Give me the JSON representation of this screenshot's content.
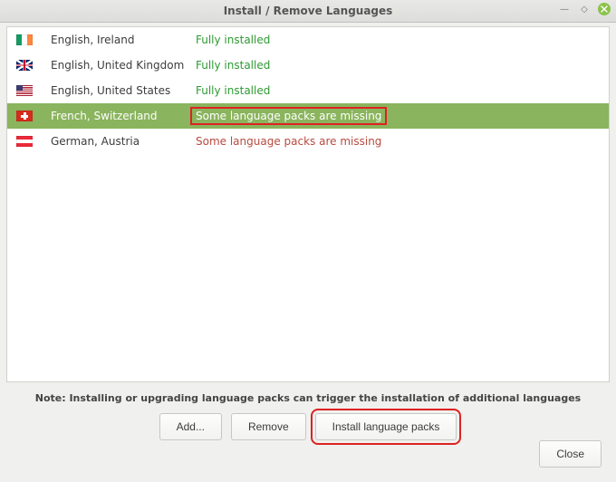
{
  "window": {
    "title": "Install / Remove Languages"
  },
  "languages": [
    {
      "name": "English, Ireland",
      "status": "Fully installed",
      "status_kind": "ok",
      "flag": "flag-ie",
      "selected": false,
      "highlight_status": false
    },
    {
      "name": "English, United Kingdom",
      "status": "Fully installed",
      "status_kind": "ok",
      "flag": "flag-gb",
      "selected": false,
      "highlight_status": false
    },
    {
      "name": "English, United States",
      "status": "Fully installed",
      "status_kind": "ok",
      "flag": "flag-us",
      "selected": false,
      "highlight_status": false
    },
    {
      "name": "French, Switzerland",
      "status": "Some language packs are missing",
      "status_kind": "missing",
      "flag": "flag-ch",
      "selected": true,
      "highlight_status": true
    },
    {
      "name": "German, Austria",
      "status": "Some language packs are missing",
      "status_kind": "missing",
      "flag": "flag-at",
      "selected": false,
      "highlight_status": false
    }
  ],
  "note": "Note: Installing or upgrading language packs can trigger the installation of additional languages",
  "buttons": {
    "add": "Add...",
    "remove": "Remove",
    "install": "Install language packs",
    "close": "Close"
  }
}
